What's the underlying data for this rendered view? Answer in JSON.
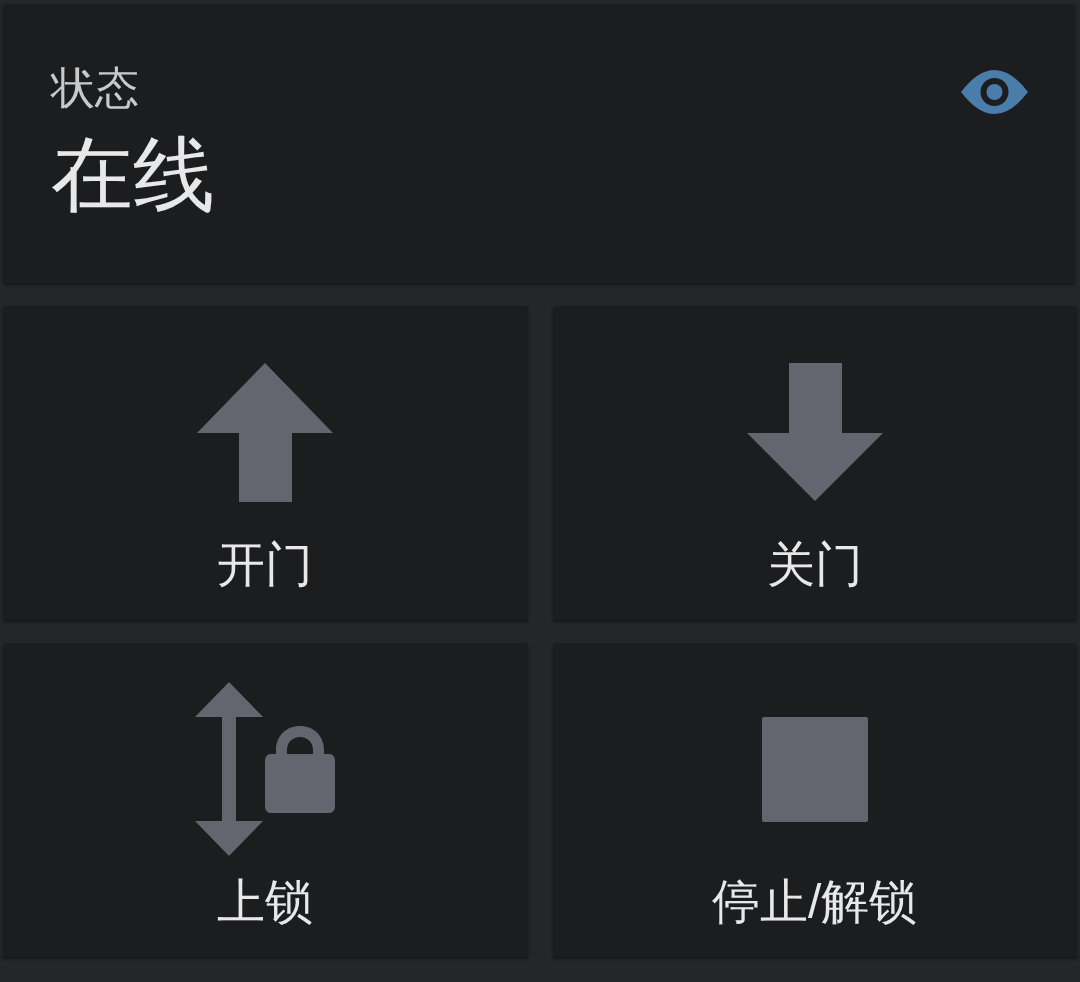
{
  "status_card": {
    "label": "状态",
    "value": "在线"
  },
  "controls": [
    {
      "kind": "up",
      "label": "开门"
    },
    {
      "kind": "down",
      "label": "关门"
    },
    {
      "kind": "lock",
      "label": "上锁"
    },
    {
      "kind": "stop",
      "label": "停止/解锁"
    }
  ]
}
